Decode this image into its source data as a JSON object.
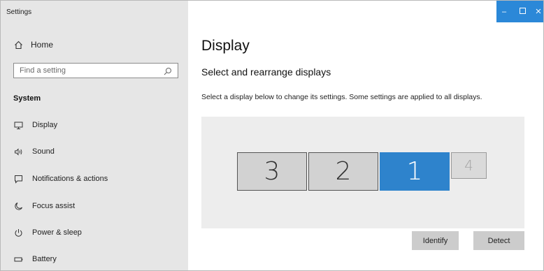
{
  "window": {
    "title": "Settings",
    "controls": [
      "minimize-icon",
      "maximize-icon",
      "close-icon"
    ],
    "accent": "#2b88d8"
  },
  "sidebar": {
    "home_label": "Home",
    "search_placeholder": "Find a setting",
    "section_label": "System",
    "items": [
      {
        "label": "Display",
        "icon": "monitor-icon"
      },
      {
        "label": "Sound",
        "icon": "speaker-icon"
      },
      {
        "label": "Notifications & actions",
        "icon": "notification-icon"
      },
      {
        "label": "Focus assist",
        "icon": "moon-icon"
      },
      {
        "label": "Power & sleep",
        "icon": "power-icon"
      },
      {
        "label": "Battery",
        "icon": "battery-icon"
      }
    ]
  },
  "main": {
    "title": "Display",
    "subtitle": "Select and rearrange displays",
    "description": "Select a display below to change its settings. Some settings are applied to all displays.",
    "displays": [
      {
        "label": "3",
        "selected": false
      },
      {
        "label": "2",
        "selected": false
      },
      {
        "label": "1",
        "selected": true
      },
      {
        "label": "4",
        "selected": false
      }
    ],
    "identify_label": "Identify",
    "detect_label": "Detect",
    "selected_color": "#2e83cc"
  }
}
